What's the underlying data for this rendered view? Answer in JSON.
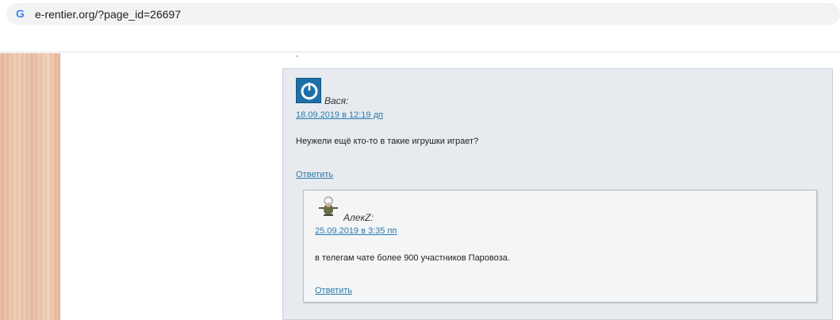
{
  "browser": {
    "url": "e-rentier.org/?page_id=26697",
    "site_icon": "google-g-icon"
  },
  "comments": [
    {
      "author": "Вася:",
      "date": "18.09.2019 в 12:19 дп",
      "text": "Неужели ещё кто-то в такие игрушки играет?",
      "reply_label": "Ответить",
      "avatar_icon": "power-icon"
    },
    {
      "author": "АлекZ:",
      "date": "25.09.2019 в 3:35 пп",
      "text": "в телегам чате более 900 участников Паровоза.",
      "reply_label": "Ответить",
      "avatar_icon": "airplane-avatar-icon"
    }
  ],
  "colors": {
    "comment_bg": "#e7ebef",
    "nested_comment_bg": "#f4f5f6",
    "link": "#2a7ab0"
  }
}
